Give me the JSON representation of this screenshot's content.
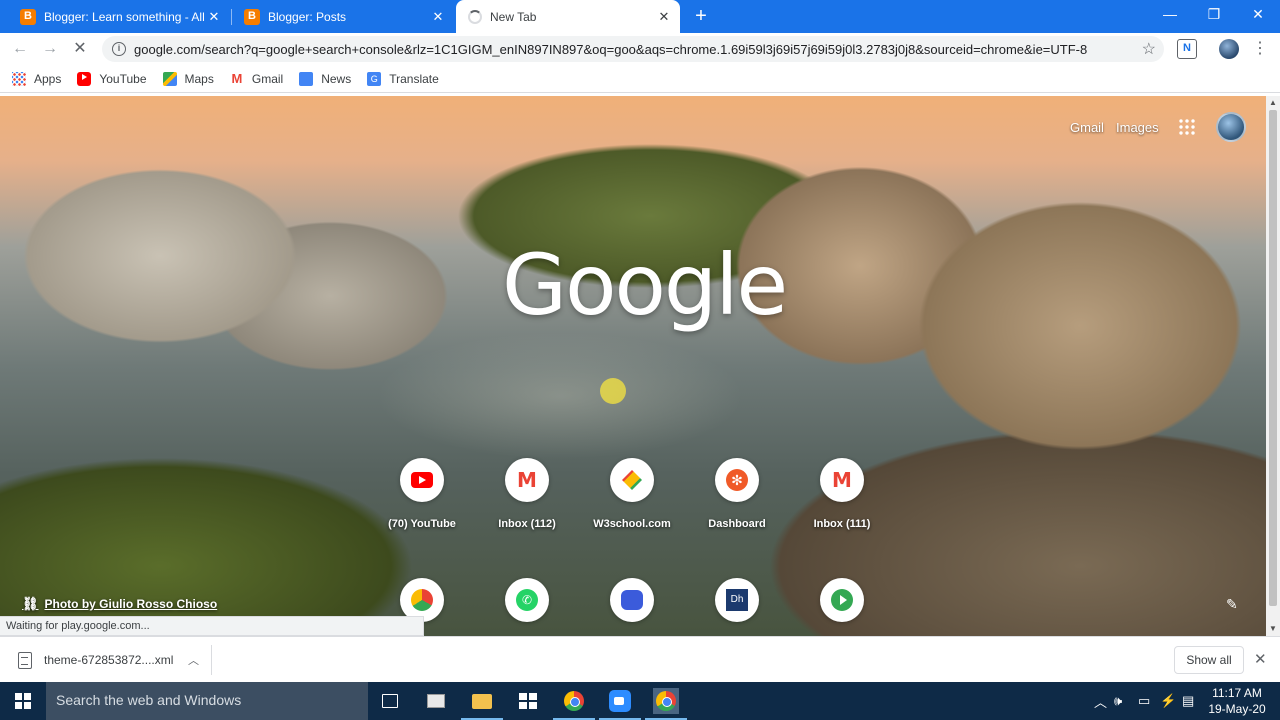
{
  "tabs": [
    {
      "title": "Blogger: Learn something - All p",
      "active": false
    },
    {
      "title": "Blogger: Posts",
      "active": false
    },
    {
      "title": "New Tab",
      "active": true,
      "loading": true
    }
  ],
  "window_controls": {
    "minimize": "—",
    "maximize": "❐",
    "close": "✕"
  },
  "toolbar": {
    "url": "google.com/search?q=google+search+console&rlz=1C1GIGM_enIN897IN897&oq=goo&aqs=chrome.1.69i59l3j69i57j69i59j0l3.2783j0j8&sourceid=chrome&ie=UTF-8",
    "extension_letter": "N"
  },
  "bookmarks": [
    {
      "label": "Apps",
      "icon": "apps-icon"
    },
    {
      "label": "YouTube",
      "icon": "youtube-icon"
    },
    {
      "label": "Maps",
      "icon": "maps-icon"
    },
    {
      "label": "Gmail",
      "icon": "gmail-icon"
    },
    {
      "label": "News",
      "icon": "news-icon"
    },
    {
      "label": "Translate",
      "icon": "translate-icon"
    }
  ],
  "ntp": {
    "gmail_link": "Gmail",
    "images_link": "Images",
    "logo": "Google",
    "photo_credit": "Photo by Giulio Rosso Chioso",
    "shortcuts_row1": [
      {
        "label": "(70) YouTube",
        "icon": "youtube-icon"
      },
      {
        "label": "Inbox (112)",
        "icon": "gmail-icon"
      },
      {
        "label": "W3school.com",
        "icon": "w3school-icon"
      },
      {
        "label": "Dashboard",
        "icon": "dashboard-icon"
      },
      {
        "label": "Inbox (111)",
        "icon": "gmail-icon"
      }
    ],
    "shortcuts_row2": [
      {
        "icon": "chrome-icon"
      },
      {
        "icon": "whatsapp-icon"
      },
      {
        "icon": "bot-icon"
      },
      {
        "icon": "dh-icon",
        "text": "Dh"
      },
      {
        "icon": "play-icon"
      }
    ]
  },
  "status_text": "Waiting for play.google.com...",
  "download_shelf": {
    "file_name": "theme-672853872....xml",
    "show_all": "Show all"
  },
  "taskbar": {
    "search_placeholder": "Search the web and Windows",
    "time": "11:17 AM",
    "date": "19-May-20"
  },
  "colors": {
    "tabstrip": "#1a73e8",
    "taskbar": "#0e2a47"
  }
}
